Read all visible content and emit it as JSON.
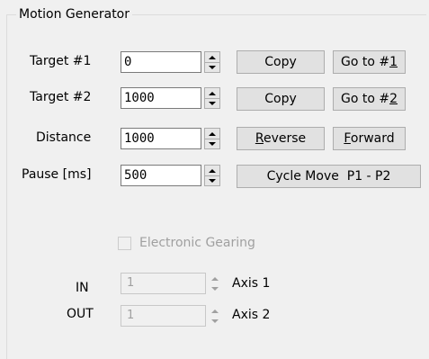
{
  "group": {
    "title": "Motion Generator"
  },
  "rows": [
    {
      "label": "Target #1",
      "value": "0",
      "button1": {
        "pre": "",
        "accel": "",
        "post": "Copy"
      },
      "button2": {
        "pre": "Go to #",
        "accel": "1",
        "post": ""
      }
    },
    {
      "label": "Target #2",
      "value": "1000",
      "button1": {
        "pre": "",
        "accel": "",
        "post": "Copy"
      },
      "button2": {
        "pre": "Go to #",
        "accel": "2",
        "post": ""
      }
    },
    {
      "label": "Distance",
      "value": "1000",
      "button1": {
        "pre": "",
        "accel": "R",
        "post": "everse"
      },
      "button2": {
        "pre": "",
        "accel": "F",
        "post": "orward"
      }
    },
    {
      "label": "Pause [ms]",
      "value": "500",
      "cycle_button": "Cycle Move  P1 - P2"
    }
  ],
  "gearing": {
    "checkbox_label": "Electronic Gearing",
    "checked": false,
    "enabled": false,
    "in": {
      "label": "IN",
      "value": "1",
      "axis_label": "Axis 1"
    },
    "out": {
      "label": "OUT",
      "value": "1",
      "axis_label": "Axis 2"
    }
  },
  "icons": {
    "spin_up": "triangle-up-icon",
    "spin_down": "triangle-down-icon"
  },
  "colors": {
    "window_bg": "#f0f0f0",
    "button_bg": "#e1e1e1",
    "disabled_text": "#a0a0a0"
  }
}
